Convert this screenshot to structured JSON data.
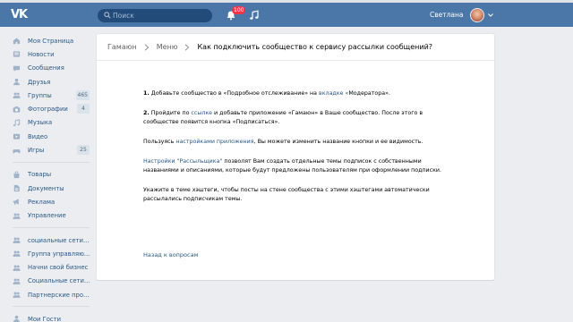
{
  "header": {
    "logo_text": "VK",
    "search_placeholder": "Поиск",
    "notifications_count": "100",
    "user_name": "Светлана"
  },
  "sidebar": {
    "groups": [
      [
        {
          "name": "sidebar-item-my-page",
          "icon": "home-icon",
          "label": "Моя Страница",
          "count": ""
        },
        {
          "name": "sidebar-item-news",
          "icon": "news-icon",
          "label": "Новости",
          "count": ""
        },
        {
          "name": "sidebar-item-messages",
          "icon": "message-icon",
          "label": "Сообщения",
          "count": ""
        },
        {
          "name": "sidebar-item-friends",
          "icon": "user-icon",
          "label": "Друзья",
          "count": ""
        },
        {
          "name": "sidebar-item-groups",
          "icon": "users-icon",
          "label": "Группы",
          "count": "465"
        },
        {
          "name": "sidebar-item-photos",
          "icon": "camera-icon",
          "label": "Фотографии",
          "count": "4"
        },
        {
          "name": "sidebar-item-music",
          "icon": "music-icon",
          "label": "Музыка",
          "count": ""
        },
        {
          "name": "sidebar-item-video",
          "icon": "video-icon",
          "label": "Видео",
          "count": ""
        },
        {
          "name": "sidebar-item-games",
          "icon": "gamepad-icon",
          "label": "Игры",
          "count": "25"
        }
      ],
      [
        {
          "name": "sidebar-item-goods",
          "icon": "bag-icon",
          "label": "Товары",
          "count": ""
        },
        {
          "name": "sidebar-item-documents",
          "icon": "document-icon",
          "label": "Документы",
          "count": ""
        },
        {
          "name": "sidebar-item-ads",
          "icon": "megaphone-icon",
          "label": "Реклама",
          "count": ""
        },
        {
          "name": "sidebar-item-management",
          "icon": "users-icon",
          "label": "Управление",
          "count": ""
        }
      ],
      [
        {
          "name": "sidebar-item-social-networks",
          "icon": "users-icon",
          "label": "социальные сети...",
          "count": ""
        },
        {
          "name": "sidebar-item-management-group",
          "icon": "users-icon",
          "label": "Группа управляю...",
          "count": ""
        },
        {
          "name": "sidebar-item-start-business",
          "icon": "users-icon",
          "label": "Начни свой бизнес",
          "count": ""
        },
        {
          "name": "sidebar-item-social-networks-2",
          "icon": "users-icon",
          "label": "Социальные сети...",
          "count": ""
        },
        {
          "name": "sidebar-item-partner-programs",
          "icon": "users-icon",
          "label": "Партнерские про...",
          "count": ""
        }
      ],
      [
        {
          "name": "sidebar-item-my-guests",
          "icon": "user-icon",
          "label": "Мои Гости",
          "count": ""
        }
      ]
    ]
  },
  "breadcrumb": {
    "items": [
      "Гамаюн",
      "Меню"
    ],
    "current": "Как подключить сообщество к сервису рассылки сообщений?"
  },
  "article": {
    "p1_num": "1.",
    "p1_a": " Добавьте сообщество в «Подробное отслеживание» на ",
    "p1_link": "вкладке «",
    "p1_b": "Модератора».",
    "p2_num": "2.",
    "p2_a": " Пройдите по ",
    "p2_link": "ссылке",
    "p2_b": " и добавьте приложение «Гамаюн» в Ваше сообщество. После этого в сообществе появится кнопка «Подписаться».",
    "p3_a": "Пользуясь ",
    "p3_link": "настройками приложения",
    "p3_b": ", Вы можете изменить название кнопки и ее видимость.",
    "p4_link": "Настройки \"Рассыльщика\"",
    "p4_b": " позволят Вам создать отдельные темы подписок с собственными названиями и описаниями, которые будут предложены пользователям при оформлении подписки.",
    "p5": "Укажите в теме хэштеги, чтобы посты на стене сообщества с этими хэштегами автоматически рассылались подписчикам темы."
  },
  "back_link": "Назад к вопросам",
  "colors": {
    "header": "#4a76a8",
    "link": "#2a5885",
    "background": "#ebedf0",
    "badge": "#ff3347"
  }
}
